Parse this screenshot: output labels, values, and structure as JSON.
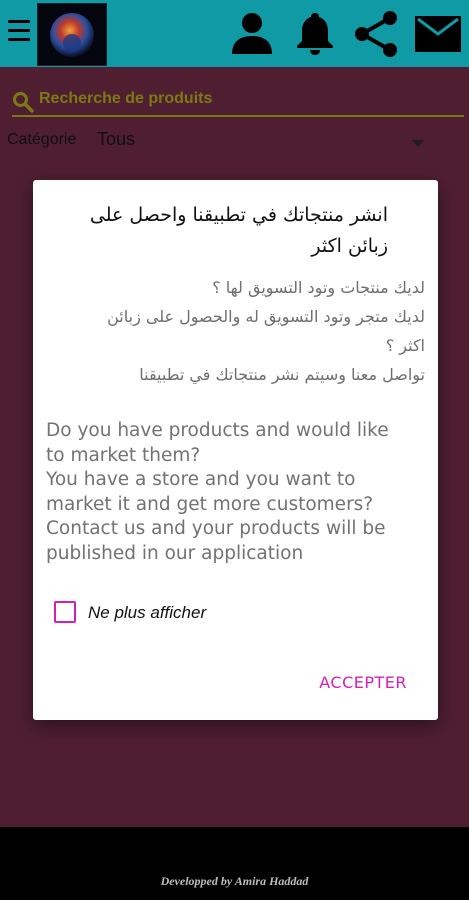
{
  "search": {
    "placeholder": "Recherche de produits"
  },
  "category": {
    "label": "Catégorie",
    "value": "Tous"
  },
  "dialog": {
    "title": "انشر منتجاتك في تطبيقنا واحصل على زبائن اكثر",
    "arabic_lines": [
      "لديك منتجات وتود التسويق لها ؟",
      "لديك متجر وتود التسويق له والحصول على زبائن",
      "اكثر ؟",
      "تواصل معنا وسيتم نشر منتجاتك في تطبيقنا"
    ],
    "english_lines": [
      "Do you have products and would like",
      "to market them?",
      "You have a store and you want to",
      "market it and get more customers?",
      "Contact us and your products will be",
      "published in our application"
    ],
    "checkbox_label": "Ne plus afficher",
    "accept_label": "ACCEPTER"
  },
  "footer": {
    "credit": "Developped by Amira Haddad"
  },
  "icons": {
    "menu": "menu-icon",
    "user": "user-icon",
    "notifications": "bell-icon",
    "share": "share-icon",
    "mail": "mail-icon",
    "search": "search-icon",
    "dropdown": "dropdown-arrow-icon"
  },
  "colors": {
    "topbar": "#0f9aa6",
    "background": "#5a2438",
    "search_accent": "#8c8a17",
    "dialog_accent": "#d21fba"
  }
}
